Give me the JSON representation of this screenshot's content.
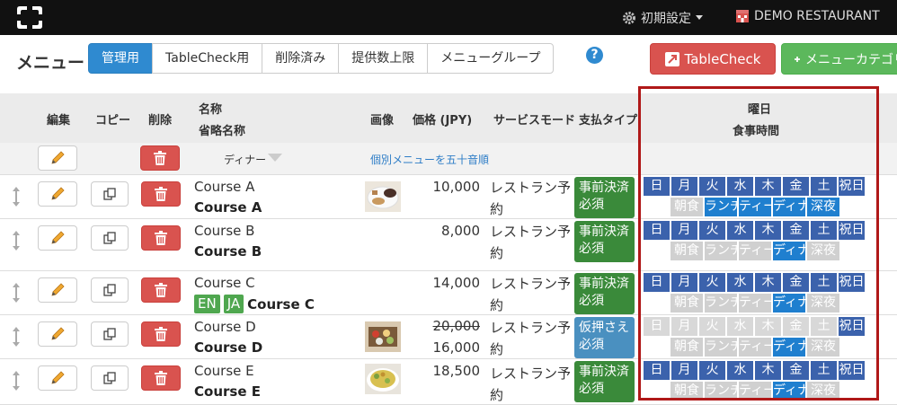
{
  "topbar": {
    "settings_label": "初期設定",
    "restaurant_label": "DEMO RESTAURANT"
  },
  "toolbar": {
    "title": "メニュー",
    "tabs": [
      {
        "label": "管理用",
        "active": true
      },
      {
        "label": "TableCheck用",
        "active": false
      },
      {
        "label": "削除済み",
        "active": false
      },
      {
        "label": "提供数上限",
        "active": false
      },
      {
        "label": "メニューグループ",
        "active": false
      }
    ],
    "help_label": "?",
    "tablecheck_button": "TableCheck",
    "add_category_button": "メニューカテゴリ"
  },
  "table": {
    "headers": {
      "edit": "編集",
      "copy": "コピー",
      "delete": "削除",
      "name": "名称",
      "short_name": "省略名称",
      "image": "画像",
      "price": "価格 (JPY)",
      "service_mode": "サービスモード",
      "payment_type": "支払タイプ",
      "weekday": "曜日",
      "meal_time": "食事時間"
    },
    "subheader": {
      "category": "ディナー",
      "sort_link": "個別メニューを五十音順"
    },
    "day_labels": [
      "日",
      "月",
      "火",
      "水",
      "木",
      "金",
      "土",
      "祝日"
    ],
    "meal_labels": [
      "朝食",
      "ランチ",
      "ティー",
      "ディナ",
      "深夜"
    ],
    "rows": [
      {
        "name": "Course A",
        "short_name": "Course A",
        "langs": [],
        "has_image": true,
        "image": "dessert-plate-thumbnail",
        "price": "10,000",
        "original_price": "",
        "mode": "レストラン予約",
        "payment": "事前決済必須",
        "payment_color": "#3a8a3a",
        "days": [
          true,
          true,
          true,
          true,
          true,
          true,
          true,
          true
        ],
        "meals": [
          false,
          true,
          true,
          true,
          true
        ]
      },
      {
        "name": "Course B",
        "short_name": "Course B",
        "langs": [],
        "has_image": false,
        "image": "",
        "price": "8,000",
        "original_price": "",
        "mode": "レストラン予約",
        "payment": "事前決済必須",
        "payment_color": "#3a8a3a",
        "days": [
          true,
          true,
          true,
          true,
          true,
          true,
          true,
          true
        ],
        "meals": [
          false,
          false,
          false,
          true,
          false
        ]
      },
      {
        "name": "Course C",
        "short_name": "Course C",
        "langs": [
          "EN",
          "JA"
        ],
        "has_image": false,
        "image": "",
        "price": "14,000",
        "original_price": "",
        "mode": "レストラン予約",
        "payment": "事前決済必須",
        "payment_color": "#3a8a3a",
        "days": [
          true,
          true,
          true,
          true,
          true,
          true,
          true,
          true
        ],
        "meals": [
          false,
          false,
          false,
          true,
          false
        ]
      },
      {
        "name": "Course D",
        "short_name": "Course D",
        "langs": [],
        "has_image": true,
        "image": "platter-thumbnail",
        "price": "16,000",
        "original_price": "20,000",
        "mode": "レストラン予約",
        "payment": "仮押さえ必須",
        "payment_color": "#4a90c0",
        "days": [
          false,
          false,
          false,
          false,
          false,
          false,
          false,
          true
        ],
        "meals": [
          false,
          false,
          false,
          true,
          false
        ]
      },
      {
        "name": "Course E",
        "short_name": "Course E",
        "langs": [],
        "has_image": true,
        "image": "salad-thumbnail",
        "price": "18,500",
        "original_price": "",
        "mode": "レストラン予約",
        "payment": "事前決済必須",
        "payment_color": "#3a8a3a",
        "days": [
          true,
          true,
          true,
          true,
          true,
          true,
          true,
          true
        ],
        "meals": [
          false,
          false,
          false,
          true,
          false
        ]
      }
    ]
  },
  "icons": {
    "logo": "tablecheck-logo-icon",
    "gear": "gear-icon",
    "building": "restaurant-icon",
    "drag": "drag-handle-icon",
    "pencil": "pencil-icon",
    "copy": "copy-icon",
    "trash": "trash-icon",
    "external": "external-link-icon",
    "plus": "plus-icon",
    "caret": "caret-down-icon"
  },
  "colors": {
    "primary": "#2f8ad0",
    "danger": "#d9534f",
    "success": "#5cb85c",
    "day_on": "#3b62ac",
    "meal_on": "#1f7fcf",
    "highlight": "#b01818"
  }
}
